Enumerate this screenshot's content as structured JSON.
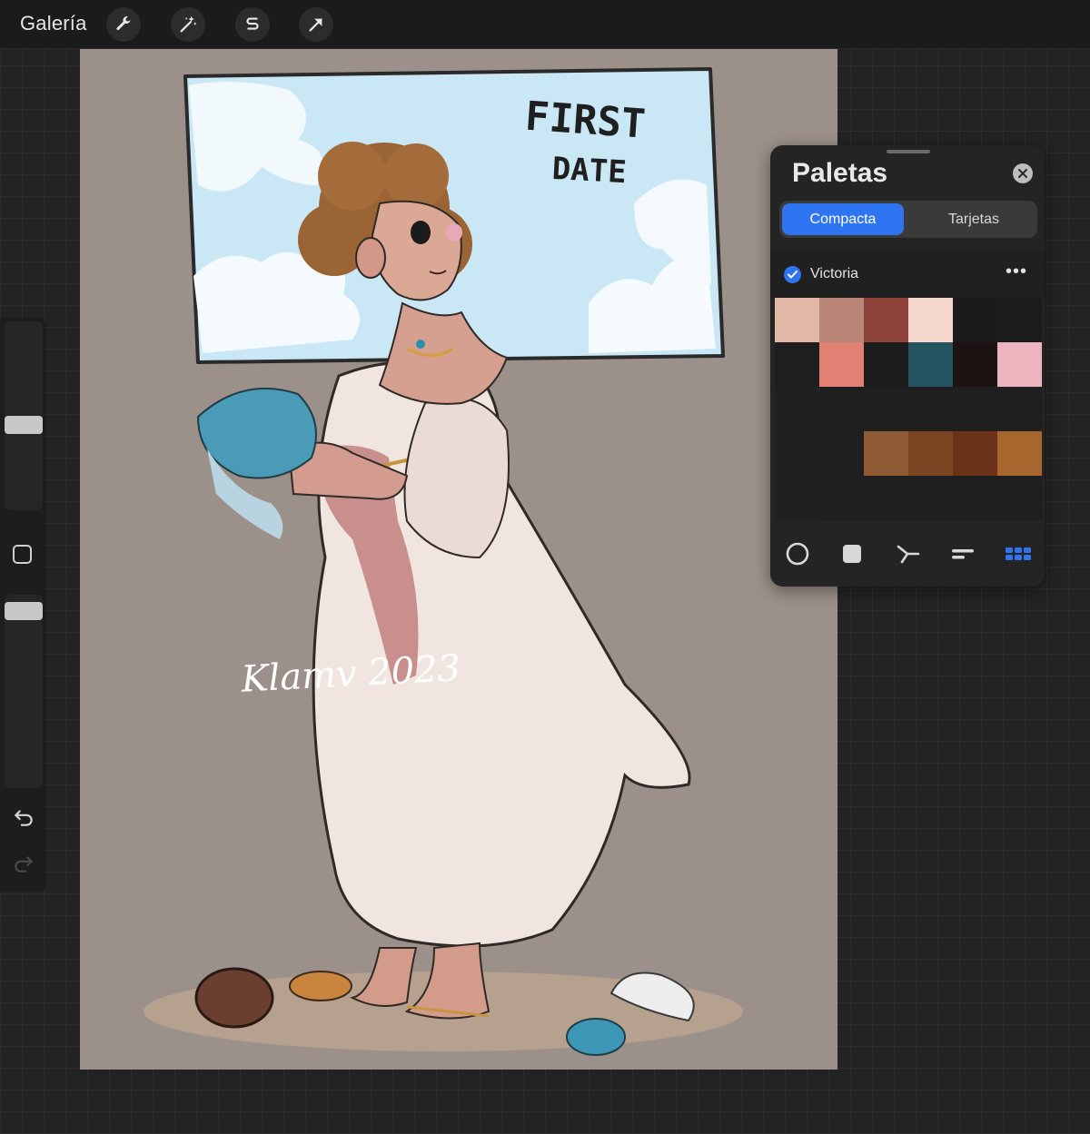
{
  "toolbar": {
    "gallery_label": "Galería",
    "tools": [
      {
        "icon": "wrench-icon"
      },
      {
        "icon": "magic-wand-icon"
      },
      {
        "icon": "selection-s-icon"
      },
      {
        "icon": "arrow-transform-icon"
      }
    ]
  },
  "sidebar": {
    "brush_size_level": 0.6,
    "opacity_level": 0.95
  },
  "artwork": {
    "sign_text": "FIRST DATE",
    "sign_line1": "FIRST",
    "sign_line2": "DATE",
    "signature": "Klamv 2023"
  },
  "palettes_panel": {
    "title": "Paletas",
    "tabs": [
      {
        "label": "Compacta",
        "active": true
      },
      {
        "label": "Tarjetas",
        "active": false
      }
    ],
    "palette_name": "Victoria",
    "palette_checked": true,
    "more_label": "•••",
    "swatches": [
      "#e2b7a6",
      "#b98576",
      "#8d433a",
      "#f5d8cb",
      "#1b1b1b",
      "#1c1c1c",
      "#1e1e1e",
      "#e08173",
      "#1c1c1c",
      "#22535f",
      "#1c1312",
      "#ecb4be",
      "#202020",
      "#1e1e1e",
      "#1f1f1f",
      "#1f1f1f",
      "#1f1f1f",
      "#1f1f1f",
      "#202020",
      "#1f1f1f",
      "#8d5a34",
      "#7a4520",
      "#6c3217",
      "#a8662f",
      "#202020",
      "#1f1f1f",
      "#1f1f1f",
      "#1f1f1f",
      "#1f1f1f",
      "#1f1f1f"
    ],
    "bottom_icons": [
      {
        "icon": "color-disc-icon",
        "active": false
      },
      {
        "icon": "color-square-icon",
        "active": false
      },
      {
        "icon": "harmony-icon",
        "active": false
      },
      {
        "icon": "value-sliders-icon",
        "active": false
      },
      {
        "icon": "palettes-grid-icon",
        "active": true
      }
    ],
    "accent": "#2f74f0"
  }
}
